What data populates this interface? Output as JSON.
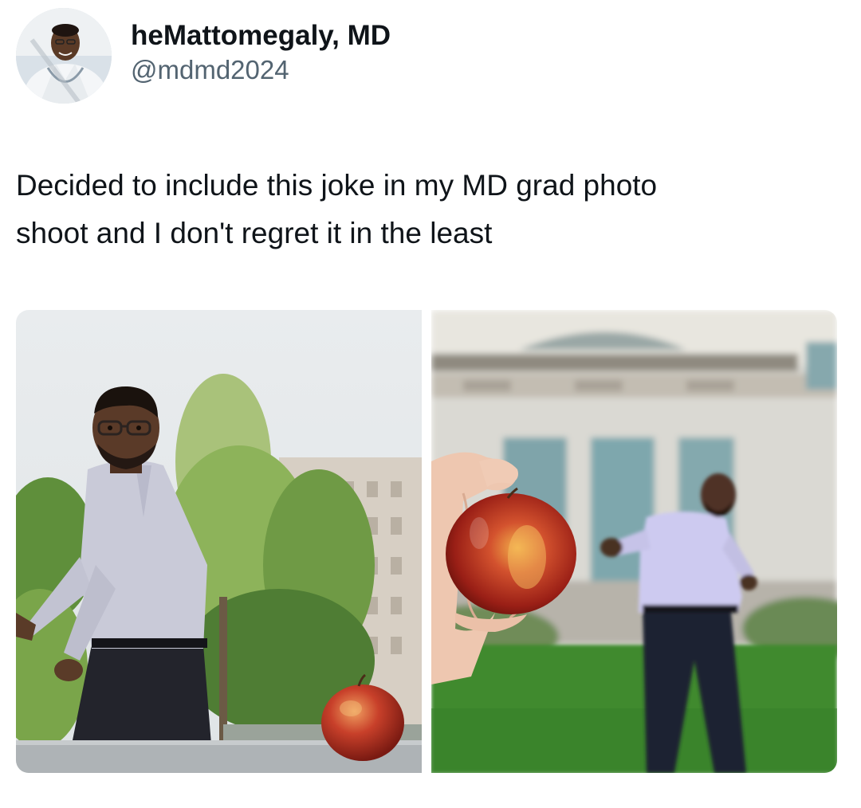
{
  "author": {
    "display_name": "heMattomegaly, MD",
    "handle": "@mdmd2024"
  },
  "tweet": {
    "text_line_1": "Decided to include this joke in my MD grad photo",
    "text_line_2": "shoot and I don't regret it in the least"
  },
  "media": {
    "count": 2
  }
}
